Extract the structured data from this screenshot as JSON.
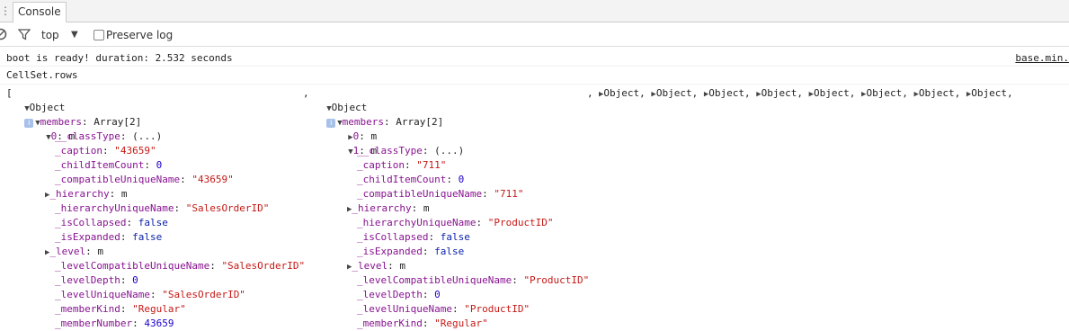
{
  "tabs": {
    "active": "Console"
  },
  "toolbar": {
    "context": "top",
    "preserve_log": "Preserve log",
    "preserve_checked": false
  },
  "log": {
    "boot_message": "boot is ready! duration: 2.532 seconds",
    "boot_source": "base.min.",
    "cellset_label": "CellSet.rows"
  },
  "array_row": {
    "open_bracket": "[",
    "object_label": "Object",
    "comma": ",",
    "collapsed_count": 8
  },
  "left_object": {
    "members_key": "members",
    "members_value": "Array[2]",
    "index0": "0",
    "index0_value": "m",
    "props": [
      {
        "key": "__classType",
        "value": "(...)",
        "type": "plain",
        "expand": false
      },
      {
        "key": "_caption",
        "value": "\"43659\"",
        "type": "str",
        "expand": false
      },
      {
        "key": "_childItemCount",
        "value": "0",
        "type": "num",
        "expand": false
      },
      {
        "key": "_compatibleUniqueName",
        "value": "\"43659\"",
        "type": "str",
        "expand": false
      },
      {
        "key": "_hierarchy",
        "value": "m",
        "type": "plain",
        "expand": true
      },
      {
        "key": "_hierarchyUniqueName",
        "value": "\"SalesOrderID\"",
        "type": "str",
        "expand": false
      },
      {
        "key": "_isCollapsed",
        "value": "false",
        "type": "kw",
        "expand": false
      },
      {
        "key": "_isExpanded",
        "value": "false",
        "type": "kw",
        "expand": false
      },
      {
        "key": "_level",
        "value": "m",
        "type": "plain",
        "expand": true
      },
      {
        "key": "_levelCompatibleUniqueName",
        "value": "\"SalesOrderID\"",
        "type": "str",
        "expand": false
      },
      {
        "key": "_levelDepth",
        "value": "0",
        "type": "num",
        "expand": false
      },
      {
        "key": "_levelUniqueName",
        "value": "\"SalesOrderID\"",
        "type": "str",
        "expand": false
      },
      {
        "key": "_memberKind",
        "value": "\"Regular\"",
        "type": "str",
        "expand": false
      },
      {
        "key": "_memberNumber",
        "value": "43659",
        "type": "num",
        "expand": false
      }
    ]
  },
  "right_object": {
    "members_key": "members",
    "members_value": "Array[2]",
    "index0": "0",
    "index0_value": "m",
    "index1": "1",
    "index1_value": "m",
    "props": [
      {
        "key": "__classType",
        "value": "(...)",
        "type": "plain",
        "expand": false
      },
      {
        "key": "_caption",
        "value": "\"711\"",
        "type": "str",
        "expand": false
      },
      {
        "key": "_childItemCount",
        "value": "0",
        "type": "num",
        "expand": false
      },
      {
        "key": "_compatibleUniqueName",
        "value": "\"711\"",
        "type": "str",
        "expand": false
      },
      {
        "key": "_hierarchy",
        "value": "m",
        "type": "plain",
        "expand": true
      },
      {
        "key": "_hierarchyUniqueName",
        "value": "\"ProductID\"",
        "type": "str",
        "expand": false
      },
      {
        "key": "_isCollapsed",
        "value": "false",
        "type": "kw",
        "expand": false
      },
      {
        "key": "_isExpanded",
        "value": "false",
        "type": "kw",
        "expand": false
      },
      {
        "key": "_level",
        "value": "m",
        "type": "plain",
        "expand": true
      },
      {
        "key": "_levelCompatibleUniqueName",
        "value": "\"ProductID\"",
        "type": "str",
        "expand": false
      },
      {
        "key": "_levelDepth",
        "value": "0",
        "type": "num",
        "expand": false
      },
      {
        "key": "_levelUniqueName",
        "value": "\"ProductID\"",
        "type": "str",
        "expand": false
      },
      {
        "key": "_memberKind",
        "value": "\"Regular\"",
        "type": "str",
        "expand": false
      }
    ]
  },
  "icons": {
    "info": "i",
    "kebab": "⋮",
    "caret": "▼",
    "expanded": "▼",
    "collapsed": "▶"
  },
  "colors": {
    "key": "#881391",
    "string": "#c41a16",
    "number": "#1c00cf",
    "keyword": "#0d22aa"
  }
}
